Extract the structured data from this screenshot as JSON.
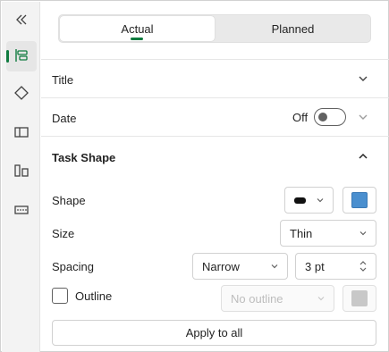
{
  "tabs": {
    "actual": "Actual",
    "planned": "Planned"
  },
  "sections": {
    "title": {
      "label": "Title"
    },
    "date": {
      "label": "Date",
      "toggle_state": "Off"
    },
    "task_shape": {
      "label": "Task Shape"
    }
  },
  "shape": {
    "label": "Shape",
    "fill_color": "#111111",
    "swatch_color": "#4a8fcf"
  },
  "size": {
    "label": "Size",
    "value": "Thin"
  },
  "spacing": {
    "label": "Spacing",
    "value": "Narrow",
    "amount": "3 pt"
  },
  "outline": {
    "label": "Outline",
    "checked": false,
    "value": "No outline",
    "swatch_color": "#c8c8c8"
  },
  "apply_label": "Apply to all",
  "colors": {
    "accent": "#0f7b3f"
  },
  "rail_icons": [
    "collapse-icon",
    "gantt-bars-icon",
    "diamond-milestone-icon",
    "split-panel-icon",
    "resize-shapes-icon",
    "ruler-icon"
  ]
}
